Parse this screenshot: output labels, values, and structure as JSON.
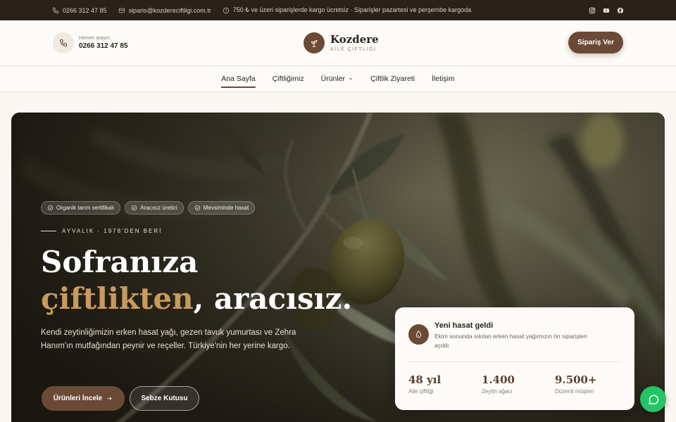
{
  "topbar": {
    "phone": "0266 312 47 85",
    "email": "siparis@kozdereciftligi.com.tr",
    "notice": "750 ₺ ve üzeri siparişlerde kargo ücretsiz · Siparişler pazartesi ve perşembe kargoda",
    "social": [
      "instagram-icon",
      "youtube-icon",
      "facebook-icon"
    ]
  },
  "header": {
    "call_label": "Hemen arayın",
    "call_number": "0266 312 47 85",
    "brand_name": "Kozdere",
    "brand_sub": "AİLE ÇİFTLİĞİ",
    "order_button": "Sipariş Ver"
  },
  "nav": {
    "items": [
      "Ana Sayfa",
      "Çiftliğimiz",
      "Ürünler",
      "Çiftlik Ziyareti",
      "İletişim"
    ],
    "active": "Ana Sayfa"
  },
  "hero": {
    "badges": [
      "Organik tarım sertifikalı",
      "Aracısız üretici",
      "Mevsiminde hasat"
    ],
    "eyebrow": "AYVALIK · 1978'DEN BERİ",
    "title_line1": "Sofranıza",
    "title_highlight": "çiftlikten",
    "title_rest": ", aracısız.",
    "lead": "Kendi zeytinliğimizin erken hasat yağı, gezen tavuk yumurtası ve Zehra Hanım'ın mutfağından peynir ve reçeller. Türkiye'nin her yerine kargo.",
    "primary_button": "Ürünleri İncele",
    "secondary_button": "Sebze Kutusu"
  },
  "card": {
    "title": "Yeni hasat geldi",
    "text": "Ekim sonunda sıkılan erken hasat yağımızın ön siparişleri açıldı.",
    "stats": [
      {
        "value": "48 yıl",
        "label": "Aile çiftliği"
      },
      {
        "value": "1.400",
        "label": "Zeytin ağacı"
      },
      {
        "value": "9.500+",
        "label": "Düzenli müşteri"
      }
    ]
  },
  "colors": {
    "accent": "#6b4a35",
    "highlight": "#c99a5b",
    "topbar": "#2a211b",
    "whatsapp": "#25c566"
  }
}
